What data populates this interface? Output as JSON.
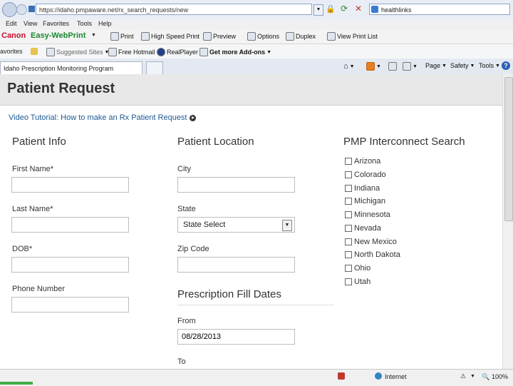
{
  "browser": {
    "url": "https://idaho.pmpaware.net/rx_search_requests/new",
    "search_value": "healthlinks",
    "menu": [
      "Edit",
      "View",
      "Favorites",
      "Tools",
      "Help"
    ],
    "canon": {
      "brand": "Canon",
      "product": "Easy-WebPrint",
      "buttons": [
        "Print",
        "High Speed Print",
        "Preview",
        "Options",
        "Duplex",
        "View Print List"
      ]
    },
    "favorites": {
      "label": "avorites",
      "items": [
        "Suggested Sites",
        "Free Hotmail",
        "RealPlayer",
        "Get more Add-ons"
      ]
    },
    "tab_title": "Idaho Prescription Monitoring Program",
    "toolbar": [
      "Page",
      "Safety",
      "Tools"
    ],
    "status": {
      "zone": "Internet",
      "zoom": "100%"
    }
  },
  "page": {
    "title": "Patient Request",
    "video_link": "Video Tutorial: How to make an Rx Patient Request"
  },
  "patient_info": {
    "title": "Patient Info",
    "first_name_label": "First Name*",
    "last_name_label": "Last Name*",
    "dob_label": "DOB*",
    "phone_label": "Phone Number"
  },
  "patient_location": {
    "title": "Patient Location",
    "city_label": "City",
    "state_label": "State",
    "state_value": "State Select",
    "zip_label": "Zip Code"
  },
  "fill_dates": {
    "title": "Prescription Fill Dates",
    "from_label": "From",
    "from_value": "08/28/2013",
    "to_label": "To"
  },
  "interconnect": {
    "title": "PMP Interconnect Search",
    "states": [
      "Arizona",
      "Colorado",
      "Indiana",
      "Michigan",
      "Minnesota",
      "Nevada",
      "New Mexico",
      "North Dakota",
      "Ohio",
      "Utah"
    ]
  }
}
